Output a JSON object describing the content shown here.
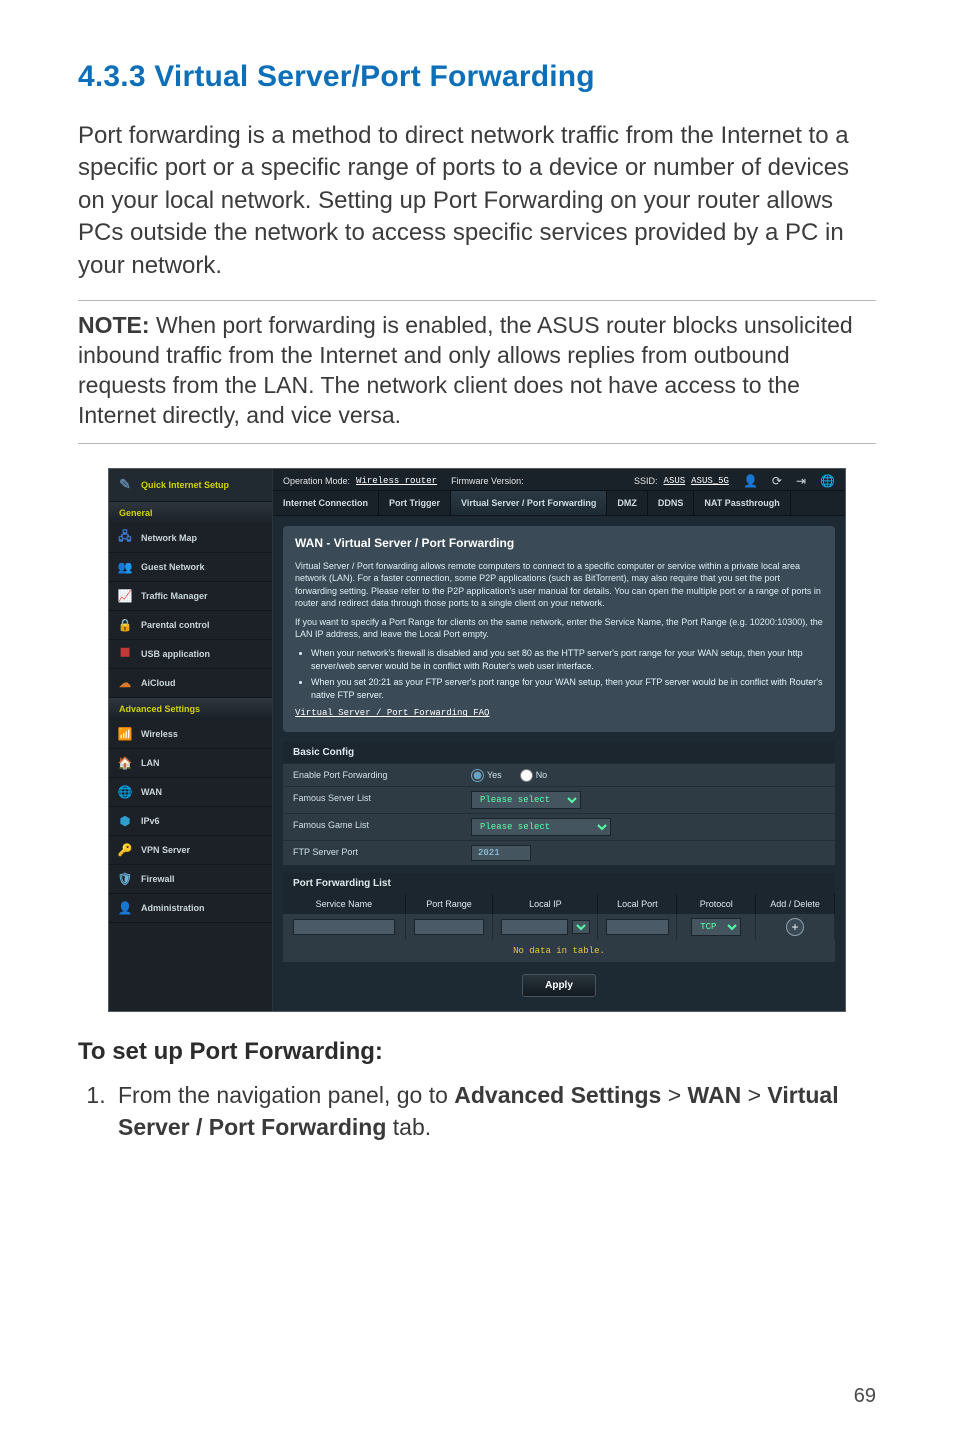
{
  "heading": "4.3.3  Virtual Server/Port Forwarding",
  "intro": "Port forwarding is a method to direct network traffic from the Internet to a specific port or a specific range of ports to a device or number of devices on your local network. Setting up Port Forwarding on your router allows PCs outside the network to access specific services provided by a PC in your network.",
  "note_label": "NOTE:",
  "note_text": "  When port forwarding is enabled, the ASUS router blocks unsolicited inbound traffic from the Internet and only allows replies from outbound requests from the LAN. The network client does not have access to the Internet directly, and vice versa.",
  "router": {
    "topbar": {
      "op_mode_label": "Operation Mode:",
      "op_mode_value": "Wireless router",
      "fw_label": "Firmware Version:",
      "ssid_label": "SSID:",
      "ssid1": "ASUS",
      "ssid2": "ASUS_5G"
    },
    "tabs": [
      "Internet Connection",
      "Port Trigger",
      "Virtual Server / Port Forwarding",
      "DMZ",
      "DDNS",
      "NAT Passthrough"
    ],
    "active_tab": 2,
    "sidebar": {
      "qis": "Quick Internet Setup",
      "general_label": "General",
      "general": [
        "Network Map",
        "Guest Network",
        "Traffic Manager",
        "Parental control",
        "USB application",
        "AiCloud"
      ],
      "advanced_label": "Advanced Settings",
      "advanced": [
        "Wireless",
        "LAN",
        "WAN",
        "IPv6",
        "VPN Server",
        "Firewall",
        "Administration"
      ]
    },
    "panel": {
      "title": "WAN - Virtual Server / Port Forwarding",
      "p1": "Virtual Server / Port forwarding allows remote computers to connect to a specific computer or service within a private local area network (LAN). For a faster connection, some P2P applications (such as BitTorrent), may also require that you set the port forwarding setting. Please refer to the P2P application's user manual for details. You can open the multiple port or a range of ports in router and redirect data through those ports to a single client on your network.",
      "p2": "If you want to specify a Port Range for clients on the same network, enter the Service Name, the Port Range (e.g. 10200:10300), the LAN IP address, and leave the Local Port empty.",
      "b1": "When your network's firewall is disabled and you set 80 as the HTTP server's port range for your WAN setup, then your http server/web server would be in conflict with Router's web user interface.",
      "b2": "When you set 20:21 as your FTP server's port range for your WAN setup, then your FTP server would be in conflict with Router's native FTP server.",
      "faq_link": "Virtual Server / Port Forwarding FAQ"
    },
    "basic": {
      "header": "Basic Config",
      "rows": {
        "enable_label": "Enable Port Forwarding",
        "yes": "Yes",
        "no": "No",
        "famous_server_label": "Famous Server List",
        "famous_server_value": "Please select",
        "famous_game_label": "Famous Game List",
        "famous_game_value": "Please select",
        "ftp_label": "FTP Server Port",
        "ftp_value": "2021"
      }
    },
    "pf": {
      "header": "Port Forwarding List",
      "cols": [
        "Service Name",
        "Port Range",
        "Local IP",
        "Local Port",
        "Protocol",
        "Add / Delete"
      ],
      "protocol_value": "TCP",
      "no_data": "No data in table."
    },
    "apply": "Apply"
  },
  "instructions": {
    "heading": "To set up Port Forwarding:",
    "step1_a": "From the navigation panel, go to ",
    "adv": "Advanced Settings",
    "gt1": " > ",
    "wan": "WAN",
    "gt2": " > ",
    "vspf": "Virtual Server / Port Forwarding",
    "tab_suffix": " tab."
  },
  "page_number": "69"
}
